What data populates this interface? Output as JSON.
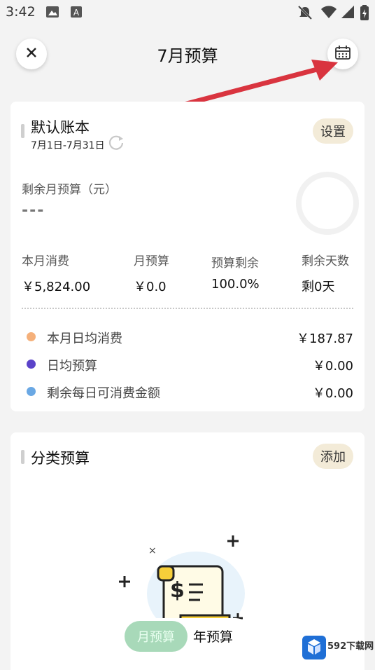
{
  "status_bar": {
    "time": "3:42"
  },
  "header": {
    "title": "7月预算"
  },
  "default_book": {
    "name": "默认账本",
    "date_range": "7月1日-7月31日",
    "settings_label": "设置",
    "remaining_label": "剩余月预算（元）",
    "remaining_value": "---",
    "stats": [
      {
        "label": "本月消费",
        "value": "￥5,824.00"
      },
      {
        "label": "月预算",
        "value": "￥0.0"
      },
      {
        "label": "预算剩余",
        "value": "100.0%"
      },
      {
        "label": "剩余天数",
        "value": "剩0天"
      }
    ],
    "rows": [
      {
        "label": "本月日均消费",
        "value": "￥187.87",
        "color": "#f5b07a"
      },
      {
        "label": "日均预算",
        "value": "￥0.00",
        "color": "#5b43c9"
      },
      {
        "label": "剩余每日可消费金额",
        "value": "￥0.00",
        "color": "#6aa8e4"
      }
    ]
  },
  "category": {
    "title": "分类预算",
    "add_label": "添加"
  },
  "tabs": {
    "active": "月预算",
    "other": "年预算"
  },
  "watermark": {
    "text": "592下载网"
  },
  "colors": {
    "accent_pill": "#f3ebd8",
    "tab_active": "#a8d9b9",
    "arrow": "#d9343f"
  }
}
